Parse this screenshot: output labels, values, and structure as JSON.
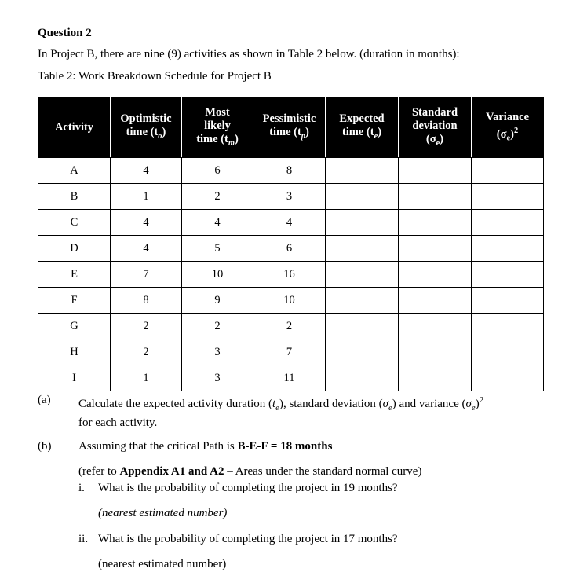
{
  "document": {
    "heading": "Question 2",
    "intro_line_1": "In Project B, there are nine (9) activities as shown in Table 2 below. (duration in months):",
    "intro_line_2": "Table 2: Work Breakdown Schedule for Project B"
  },
  "table": {
    "headers": [
      {
        "line1": "Activity",
        "line2": "",
        "line3": ""
      },
      {
        "line1": "Optimistic",
        "line2": "time (t",
        "sub": "o",
        "line3": ")"
      },
      {
        "line1": "Most",
        "line2": "likely",
        "line3": "time (t",
        "sub": "m",
        "tail": ")"
      },
      {
        "line1": "Pessimistic",
        "line2": "time (t",
        "sub": "p",
        "line3": ")"
      },
      {
        "line1": "Expected",
        "line2": "time (t",
        "sub": "e",
        "line3": ")"
      },
      {
        "line1": "Standard",
        "line2": "deviation",
        "line3": "(σ",
        "sub": "e",
        "tail": ")"
      },
      {
        "line1": "Variance",
        "line2": "(σ",
        "sub": "e",
        "tail": ")",
        "sup": "2"
      }
    ],
    "header_labels": [
      "Activity",
      "Optimistic time (to)",
      "Most likely time (tm)",
      "Pessimistic time (tp)",
      "Expected time (te)",
      "Standard deviation (σe)",
      "Variance (σe)²"
    ],
    "rows": [
      {
        "activity": "A",
        "optimistic": "4",
        "most_likely": "6",
        "pessimistic": "8",
        "expected": "",
        "std_dev": "",
        "variance": ""
      },
      {
        "activity": "B",
        "optimistic": "1",
        "most_likely": "2",
        "pessimistic": "3",
        "expected": "",
        "std_dev": "",
        "variance": ""
      },
      {
        "activity": "C",
        "optimistic": "4",
        "most_likely": "4",
        "pessimistic": "4",
        "expected": "",
        "std_dev": "",
        "variance": ""
      },
      {
        "activity": "D",
        "optimistic": "4",
        "most_likely": "5",
        "pessimistic": "6",
        "expected": "",
        "std_dev": "",
        "variance": ""
      },
      {
        "activity": "E",
        "optimistic": "7",
        "most_likely": "10",
        "pessimistic": "16",
        "expected": "",
        "std_dev": "",
        "variance": ""
      },
      {
        "activity": "F",
        "optimistic": "8",
        "most_likely": "9",
        "pessimistic": "10",
        "expected": "",
        "std_dev": "",
        "variance": ""
      },
      {
        "activity": "G",
        "optimistic": "2",
        "most_likely": "2",
        "pessimistic": "2",
        "expected": "",
        "std_dev": "",
        "variance": ""
      },
      {
        "activity": "H",
        "optimistic": "2",
        "most_likely": "3",
        "pessimistic": "7",
        "expected": "",
        "std_dev": "",
        "variance": ""
      },
      {
        "activity": "I",
        "optimistic": "1",
        "most_likely": "3",
        "pessimistic": "11",
        "expected": "",
        "std_dev": "",
        "variance": ""
      }
    ]
  },
  "questions": {
    "a": {
      "marker": "(a)",
      "text_part1": "Calculate the expected activity duration (",
      "sym1": "t",
      "sub1": "e",
      "text_part2": "), standard deviation (",
      "sym2": "σ",
      "sub2": "e",
      "text_part3": ") and variance (",
      "sym3": "σ",
      "sub3": "e",
      "text_part4": ")",
      "sup4": "2",
      "line2": "for each activity.",
      "full_text": "Calculate the expected activity duration (te), standard deviation (σe) and variance (σe)2 for each activity."
    },
    "b": {
      "marker": "(b)",
      "text_prefix": "Assuming that the critical Path is ",
      "text_bold": "B-E-F = 18 months",
      "reference_prefix": "(refer to ",
      "reference_bold": "Appendix A1 and A2",
      "reference_suffix": " – Areas under the standard normal curve)",
      "items": [
        {
          "marker": "i.",
          "text": "What is the probability of completing the project in 19 months?",
          "note": "(nearest estimated number)"
        },
        {
          "marker": "ii.",
          "text": "What is the probability of completing the project in 17 months?",
          "note": "(nearest estimated number)"
        }
      ]
    }
  }
}
